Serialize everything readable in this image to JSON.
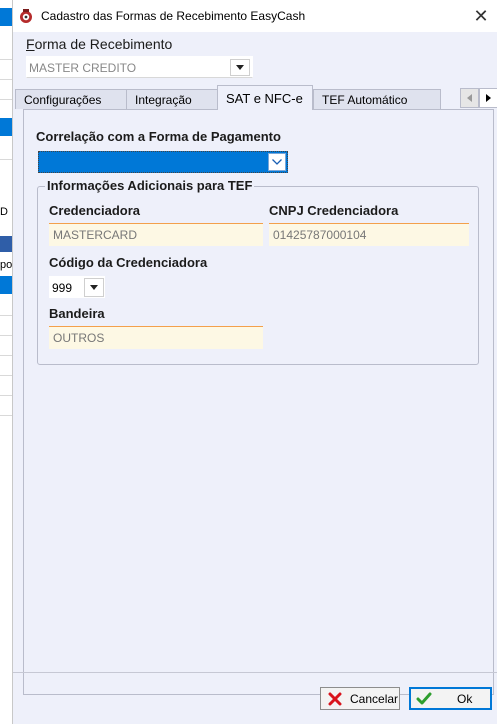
{
  "window": {
    "title": "Cadastro das Formas de Recebimento EasyCash",
    "close_glyph": "✕"
  },
  "background_app": {
    "fragment_1": "D",
    "fragment_2": "po"
  },
  "form": {
    "forma_label_prefix": "F",
    "forma_label_rest": "orma de Recebimento",
    "forma_value": "MASTER CREDITO"
  },
  "tabs": [
    {
      "label": "Configurações",
      "active": false
    },
    {
      "label": "Integração",
      "active": false
    },
    {
      "label": "SAT e NFC-e",
      "active": true
    },
    {
      "label": "TEF Automático",
      "active": false
    }
  ],
  "sat_tab": {
    "correlacao_label": "Correlação com a Forma de Pagamento",
    "correlacao_value": "",
    "group_title": "Informações Adicionais para TEF",
    "credenciadora_label": "Credenciadora",
    "credenciadora_value": "MASTERCARD",
    "cnpj_label": "CNPJ Credenciadora",
    "cnpj_value": "01425787000104",
    "codigo_label": "Código da Credenciadora",
    "codigo_value": "999",
    "bandeira_label": "Bandeira",
    "bandeira_value": "OUTROS"
  },
  "buttons": {
    "cancel_label": "Cancelar",
    "ok_label": "Ok"
  },
  "colors": {
    "accent": "#0078d7",
    "field_bg": "#fdf8e4",
    "field_border": "#f3a04b",
    "cancel_icon": "#d9141c",
    "ok_icon": "#2e9e2e"
  },
  "icons": {
    "app": "easycash-app-icon",
    "close": "close-icon",
    "dropdown": "chevron-down-icon",
    "tab_prev": "triangle-left-icon",
    "tab_next": "triangle-right-icon",
    "cancel": "red-x-icon",
    "ok": "green-check-icon"
  }
}
